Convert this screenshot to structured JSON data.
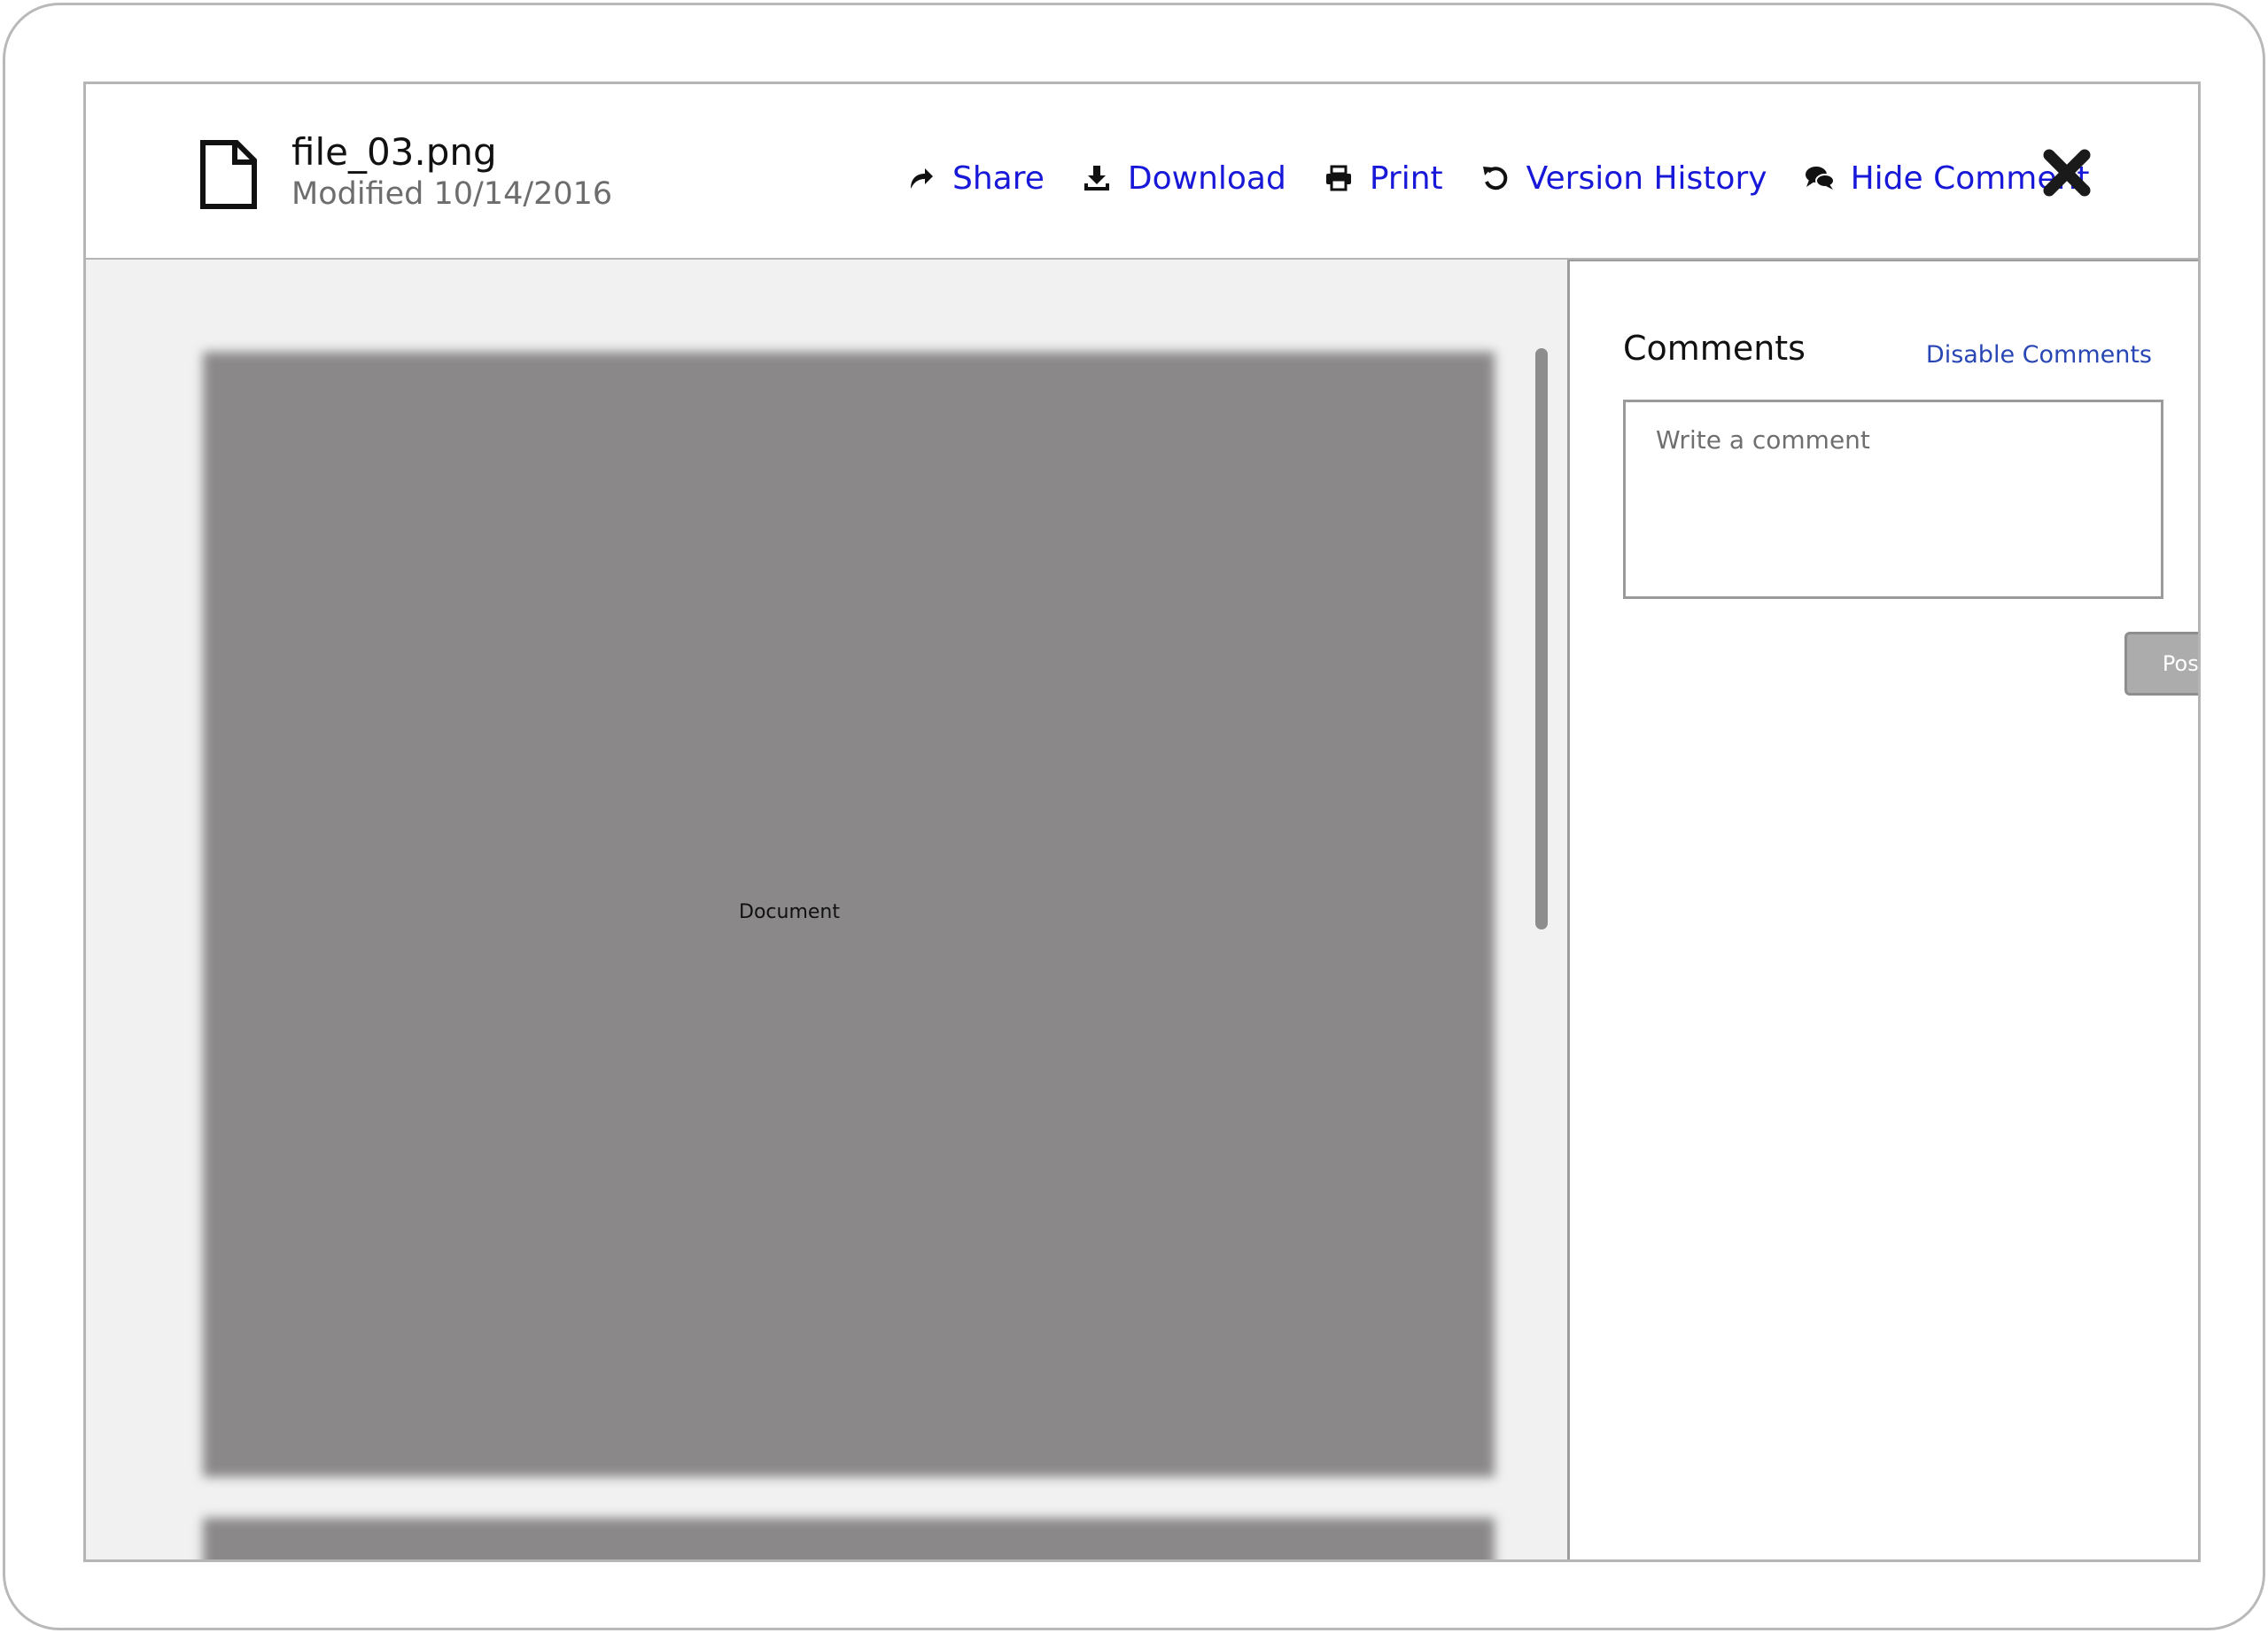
{
  "header": {
    "file_name": "file_03.png",
    "modified": "Modified 10/14/2016",
    "file_icon": "file-icon"
  },
  "toolbar": {
    "items": [
      {
        "label": "Share",
        "icon": "share-icon"
      },
      {
        "label": "Download",
        "icon": "download-icon"
      },
      {
        "label": "Print",
        "icon": "print-icon"
      },
      {
        "label": "Version History",
        "icon": "history-icon"
      },
      {
        "label": "Hide Comment",
        "icon": "comments-icon"
      }
    ],
    "close_icon": "close-icon",
    "link_color": "#1818d8"
  },
  "viewer": {
    "page_label": "Document"
  },
  "comments": {
    "title": "Comments",
    "disable_label": "Disable Comments",
    "input_placeholder": "Write a comment",
    "input_value": "",
    "post_label": "Post"
  }
}
